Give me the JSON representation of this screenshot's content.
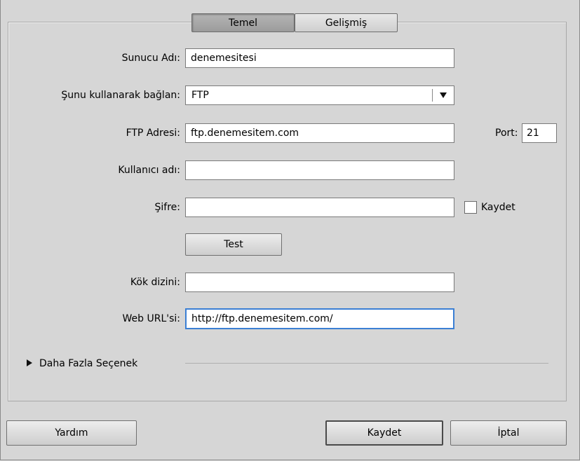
{
  "tabs": [
    {
      "label": "Temel",
      "active": true
    },
    {
      "label": "Gelişmiş",
      "active": false
    }
  ],
  "form": {
    "server_name": {
      "label": "Sunucu Adı:",
      "value": "denemesitesi"
    },
    "connect_using": {
      "label": "Şunu kullanarak bağlan:",
      "value": "FTP"
    },
    "ftp_address": {
      "label": "FTP Adresi:",
      "value": "ftp.denemesitem.com"
    },
    "port": {
      "label": "Port:",
      "value": "21"
    },
    "username": {
      "label": "Kullanıcı adı:",
      "value": ""
    },
    "password": {
      "label": "Şifre:",
      "value": ""
    },
    "save_password": {
      "label": "Kaydet",
      "checked": false
    },
    "test_button": "Test",
    "root_dir": {
      "label": "Kök dizini:",
      "value": ""
    },
    "web_url": {
      "label": "Web URL'si:",
      "value": "http://ftp.denemesitem.com/"
    },
    "more_options": "Daha Fazla Seçenek"
  },
  "footer": {
    "help": "Yardım",
    "save": "Kaydet",
    "cancel": "İptal"
  },
  "icons": {
    "dropdown_arrow": "triangle-down-icon",
    "disclosure": "triangle-right-icon"
  },
  "colors": {
    "background": "#d6d6d6",
    "focus_border": "#3b7fd4"
  }
}
